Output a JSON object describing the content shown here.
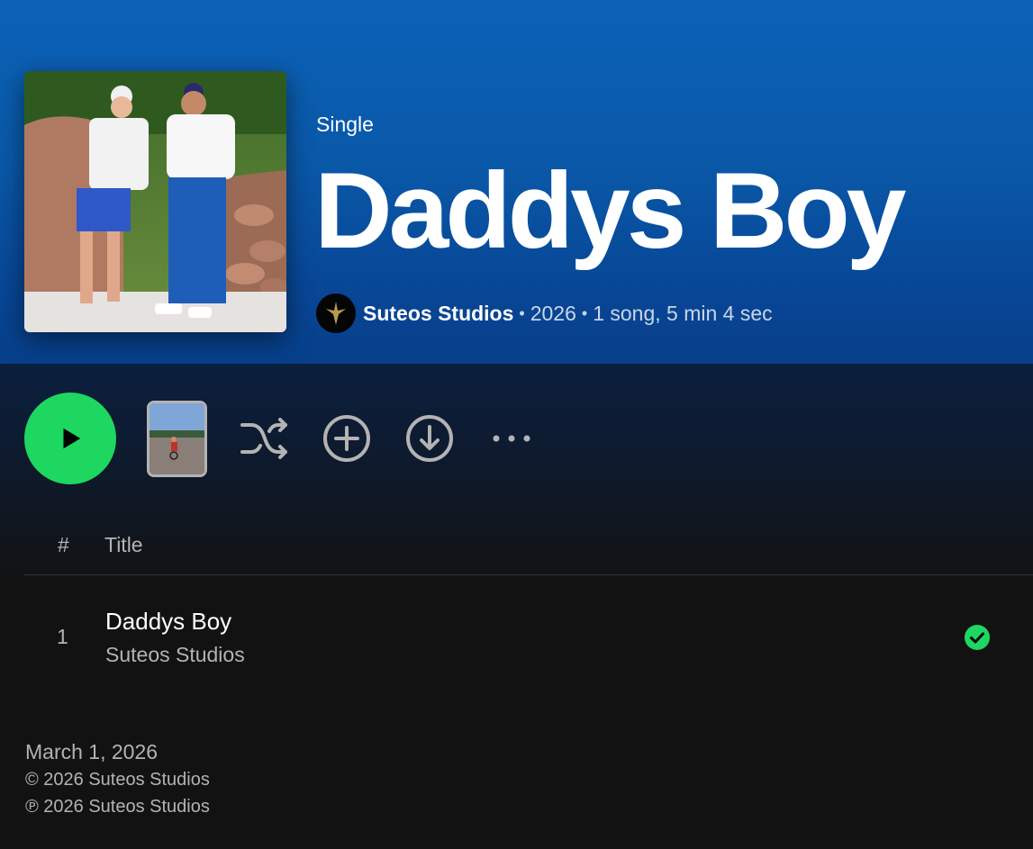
{
  "colors": {
    "header_top": "#0b62b8",
    "header_bottom": "#073f8a",
    "background": "#121212",
    "accent_green": "#1ed760",
    "muted_text": "#b3b3b3"
  },
  "album": {
    "type_label": "Single",
    "title": "Daddys Boy",
    "cover_icon": "album-cover-photo",
    "artist": {
      "name": "Suteos Studios",
      "avatar_icon": "artist-logo-avatar"
    },
    "separator": "•",
    "year": "2026",
    "summary": "1 song, 5 min 4 sec"
  },
  "actions": {
    "play_icon": "play-icon",
    "preview_icon": "video-preview-thumbnail",
    "shuffle_icon": "shuffle-icon",
    "add_icon": "plus-circle-icon",
    "download_icon": "download-icon",
    "more_label": "• • •"
  },
  "tracklist": {
    "header_num": "#",
    "header_title": "Title",
    "tracks": [
      {
        "num": "1",
        "title": "Daddys Boy",
        "artist": "Suteos Studios",
        "status_icon": "saved-check-icon"
      }
    ]
  },
  "footer": {
    "release_date": "March 1, 2026",
    "copyright": "© 2026 Suteos Studios",
    "phonogram": "℗ 2026 Suteos Studios"
  }
}
